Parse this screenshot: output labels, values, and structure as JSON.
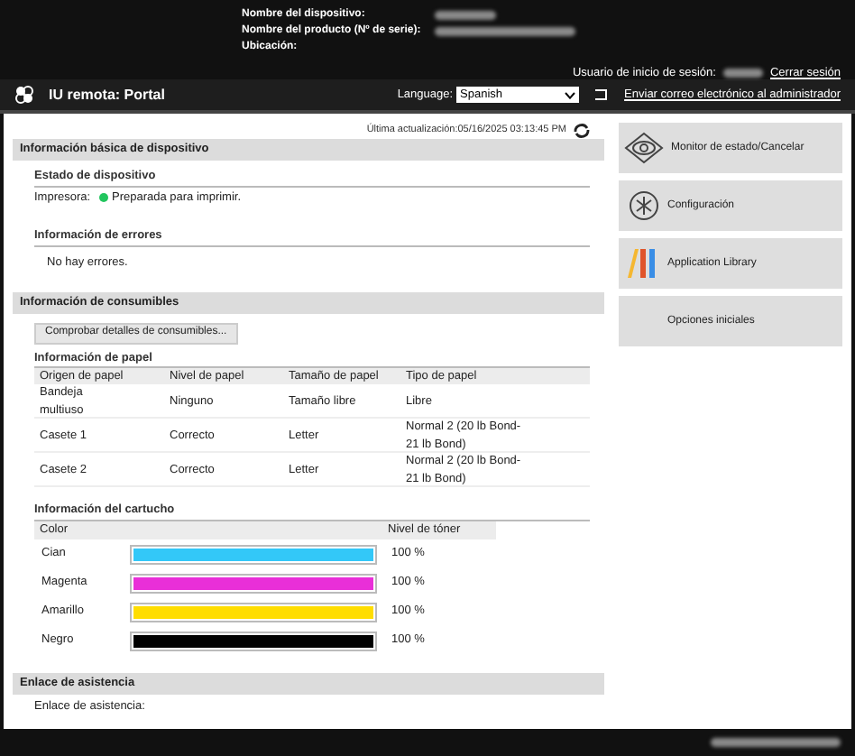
{
  "header": {
    "fields": [
      {
        "label": "Nombre del dispositivo:"
      },
      {
        "label": "Nombre del producto (Nº de serie):"
      },
      {
        "label": "Ubicación:"
      }
    ],
    "login_label": "Usuario de inicio de sesión:",
    "logout": "Cerrar sesión"
  },
  "nav": {
    "title": "IU remota: Portal",
    "language_label": "Language:",
    "language": "Spanish",
    "email_link": "Enviar correo electrónico al administrador"
  },
  "last_update": "Última actualización:05/16/2025 03:13:45 PM",
  "basic": {
    "title": "Información básica de dispositivo",
    "status_title": "Estado de dispositivo",
    "printer_label": "Impresora:",
    "status": "Preparada para imprimir.",
    "ready": true,
    "errors_title": "Información de errores",
    "errors": "No hay errores."
  },
  "consumables": {
    "title": "Información de consumibles",
    "button": "Comprobar detalles de consumibles...",
    "paper_title": "Información de papel",
    "paper_columns": [
      "Origen de papel",
      "Nivel de papel",
      "Tamaño de papel",
      "Tipo de papel"
    ],
    "paper_rows": [
      [
        "Bandeja multiuso",
        "Ninguno",
        "Tamaño libre",
        "Libre"
      ],
      [
        "Casete 1",
        "Correcto",
        "Letter",
        "Normal 2 (20 lb Bond-21 lb Bond)"
      ],
      [
        "Casete 2",
        "Correcto",
        "Letter",
        "Normal 2 (20 lb Bond-21 lb Bond)"
      ]
    ],
    "cartridge_title": "Información del cartucho",
    "cartridge_columns": [
      "Color",
      "Nivel de tóner"
    ],
    "cartridges": [
      {
        "name": "Cian",
        "color": "#33c8f8",
        "level": 1,
        "reading": "100 %"
      },
      {
        "name": "Magenta",
        "color": "#e92fd8",
        "level": 1,
        "reading": "100 %"
      },
      {
        "name": "Amarillo",
        "color": "#ffdd00",
        "level": 1,
        "reading": "100 %"
      },
      {
        "name": "Negro",
        "color": "#000000",
        "level": 1,
        "reading": "100 %"
      }
    ]
  },
  "support": {
    "title": "Enlace de asistencia",
    "label": "Enlace de asistencia:"
  },
  "menu": [
    {
      "kind": "eye",
      "label": "Monitor de estado/Cancelar"
    },
    {
      "kind": "gear",
      "label": "Configuración"
    },
    {
      "kind": "apps",
      "label": "Application Library"
    },
    {
      "kind": "none",
      "label": "Opciones iniciales"
    }
  ]
}
